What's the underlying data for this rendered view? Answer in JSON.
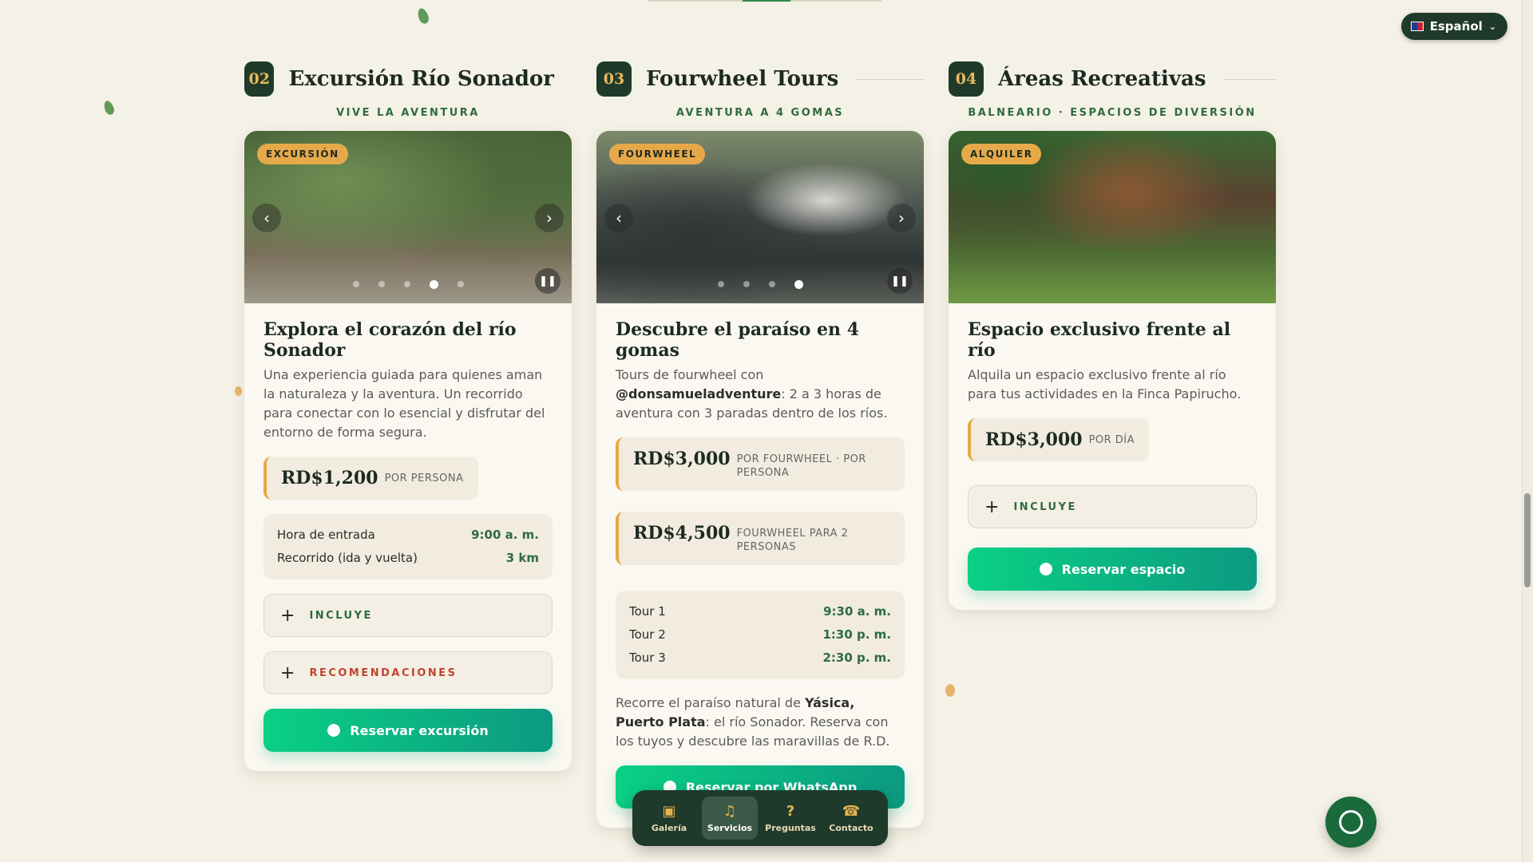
{
  "language": {
    "label": "Español"
  },
  "services": [
    {
      "number": "02",
      "title": "Excursión Río Sonador",
      "subtitle": "VIVE LA AVENTURA",
      "badge": "EXCURSIÓN",
      "heading": "Explora el corazón del río Sonador",
      "description": "Una experiencia guiada para quienes aman la naturaleza y la aventura. Un recorrido para conectar con lo esencial y disfrutar del entorno de forma segura.",
      "prices": [
        {
          "amount": "RD$1,200",
          "unit": "POR PERSONA"
        }
      ],
      "schedule": [
        {
          "label": "Hora de entrada",
          "value": "9:00 a. m."
        },
        {
          "label": "Recorrido (ida y vuelta)",
          "value": "3 km"
        }
      ],
      "accordions": [
        "INCLUYE",
        "RECOMENDACIONES"
      ],
      "cta": "Reservar excursión"
    },
    {
      "number": "03",
      "title": "Fourwheel Tours",
      "subtitle": "AVENTURA A 4 GOMAS",
      "badge": "FOURWHEEL",
      "heading": "Descubre el paraíso en 4 gomas",
      "desc_pre": "Tours de fourwheel con ",
      "desc_bold": "@donsamueladventure",
      "desc_post": ": 2 a 3 horas de aventura con 3 paradas dentro de los ríos.",
      "prices": [
        {
          "amount": "RD$3,000",
          "unit": "POR FOURWHEEL · POR PERSONA"
        },
        {
          "amount": "RD$4,500",
          "unit": "FOURWHEEL PARA 2 PERSONAS"
        }
      ],
      "schedule": [
        {
          "label": "Tour 1",
          "value": "9:30 a. m."
        },
        {
          "label": "Tour 2",
          "value": "1:30 p. m."
        },
        {
          "label": "Tour 3",
          "value": "2:30 p. m."
        }
      ],
      "extra_pre": "Recorre el paraíso natural de ",
      "extra_bold": "Yásica, Puerto Plata",
      "extra_post": ": el río Sonador. Reserva con los tuyos y descubre las maravillas de R.D.",
      "cta": "Reservar por WhatsApp"
    },
    {
      "number": "04",
      "title": "Áreas Recreativas",
      "subtitle": "BALNEARIO · ESPACIOS DE DIVERSIÓN",
      "badge": "ALQUILER",
      "heading": "Espacio exclusivo frente al río",
      "description": "Alquila un espacio exclusivo frente al río para tus actividades en la Finca Papirucho.",
      "prices": [
        {
          "amount": "RD$3,000",
          "unit": "POR DÍA"
        }
      ],
      "accordions": [
        "INCLUYE"
      ],
      "cta": "Reservar espacio"
    }
  ],
  "bottom_nav": [
    {
      "label": "Galería",
      "icon": "image-icon"
    },
    {
      "label": "Servicios",
      "icon": "bell-icon",
      "active": true
    },
    {
      "label": "Preguntas",
      "icon": "help-icon"
    },
    {
      "label": "Contacto",
      "icon": "phone-icon"
    }
  ],
  "colors": {
    "brand_dark": "#1f3a2b",
    "accent": "#e6a94a",
    "green": "#2f6b3f",
    "cta": "#0ad084"
  }
}
